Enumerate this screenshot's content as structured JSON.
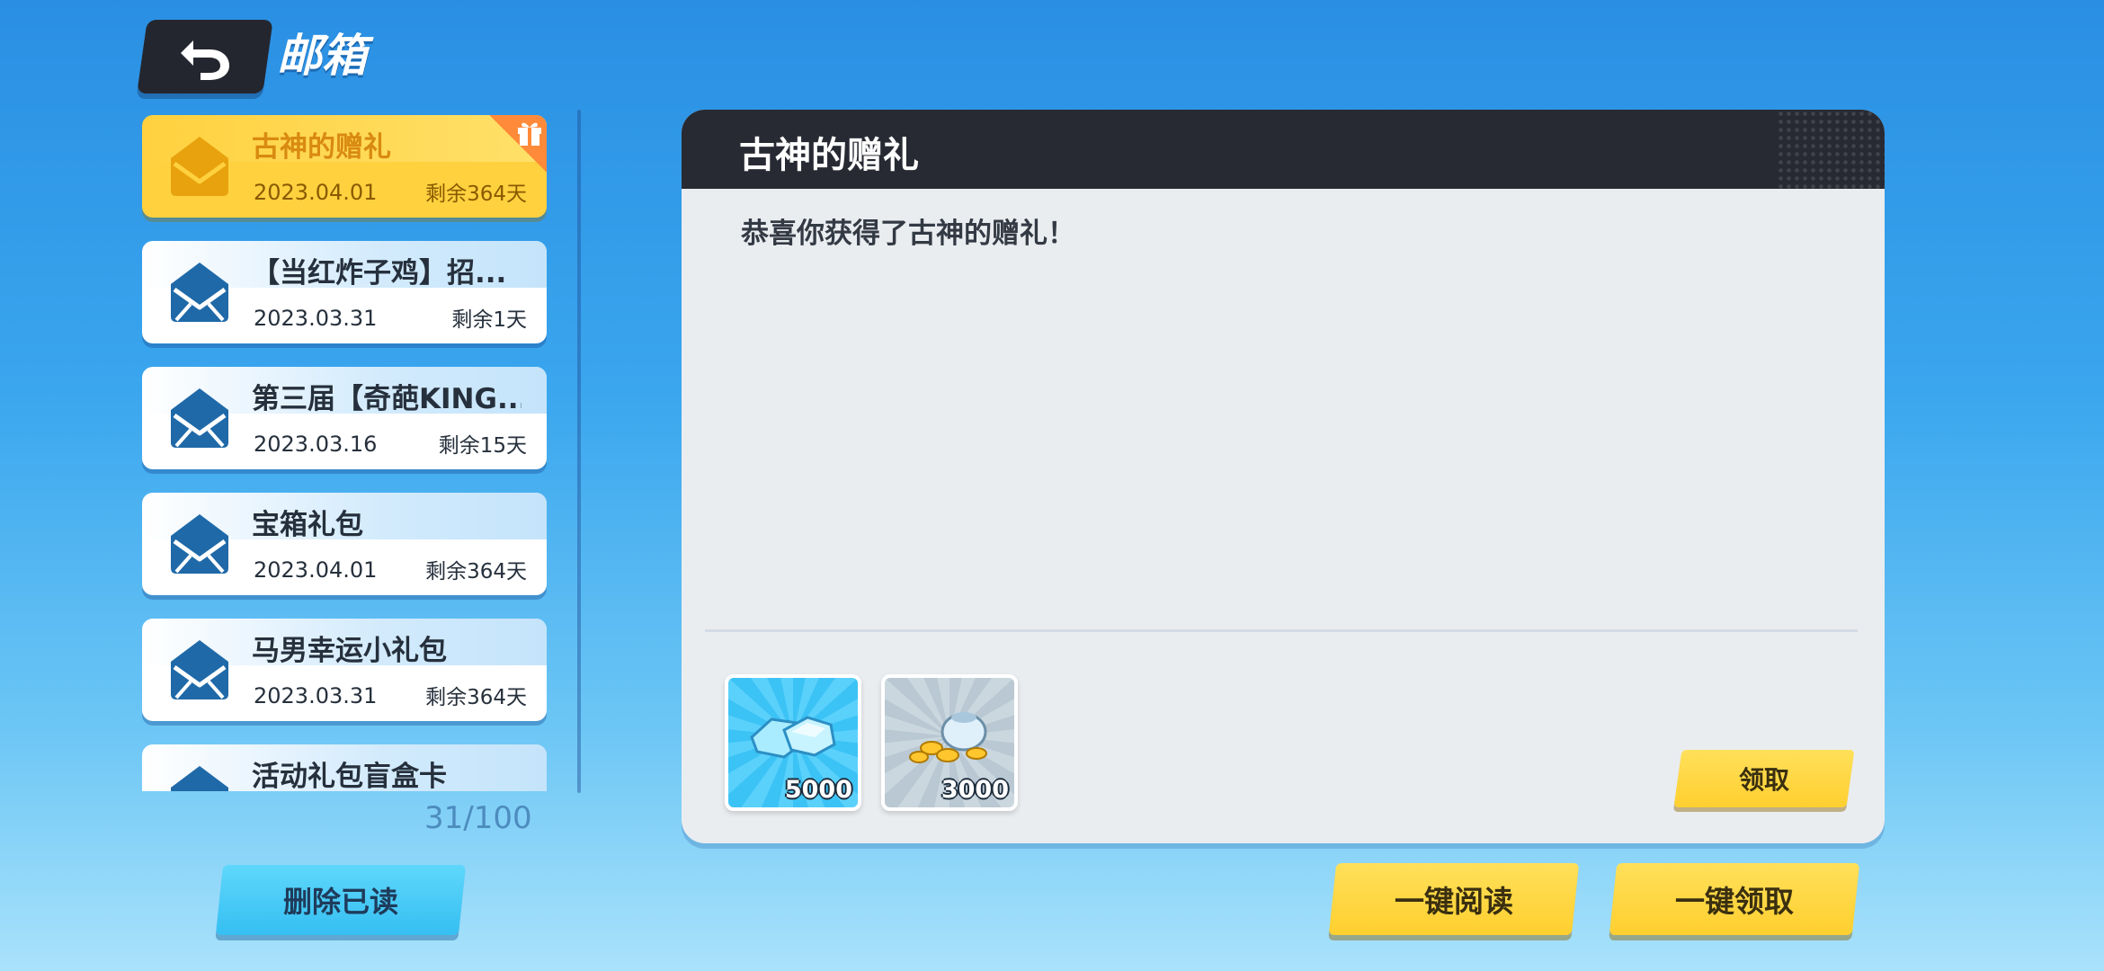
{
  "header": {
    "title": "邮箱"
  },
  "mails": [
    {
      "title": "古神的赠礼",
      "date": "2023.04.01",
      "remaining": "剩余364天",
      "selected": true,
      "has_gift": true
    },
    {
      "title": "【当红炸子鸡】招...",
      "date": "2023.03.31",
      "remaining": "剩余1天"
    },
    {
      "title": "第三届【奇葩KING...",
      "date": "2023.03.16",
      "remaining": "剩余15天"
    },
    {
      "title": "宝箱礼包",
      "date": "2023.04.01",
      "remaining": "剩余364天"
    },
    {
      "title": "马男幸运小礼包",
      "date": "2023.03.31",
      "remaining": "剩余364天"
    },
    {
      "title": "活动礼包盲盒卡",
      "date": "",
      "remaining": ""
    }
  ],
  "mail_count": "31/100",
  "detail": {
    "title": "古神的赠礼",
    "body": "恭喜你获得了古神的赠礼！",
    "rewards": [
      {
        "icon": "diamond-icon",
        "quantity": "5000"
      },
      {
        "icon": "coin-bag-icon",
        "quantity": "3000"
      }
    ],
    "claim_label": "领取"
  },
  "buttons": {
    "delete_read": "删除已读",
    "read_all": "一键阅读",
    "claim_all": "一键领取"
  },
  "colors": {
    "accent_yellow": "#ffd13f",
    "accent_cyan": "#35bff2",
    "panel_header": "#272a33",
    "gift_corner": "#ff8a3a"
  }
}
